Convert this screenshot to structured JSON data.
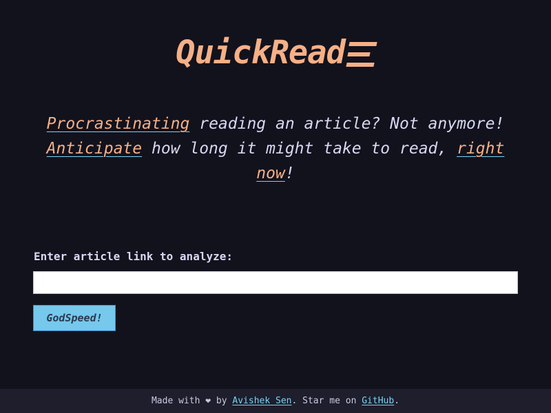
{
  "header": {
    "title": "QuickRead",
    "logo_icon": "hamburger-lines-icon"
  },
  "tagline": {
    "highlight_1": "Procrastinating",
    "text_1": " reading an article? Not anymore! ",
    "highlight_2": "Anticipate",
    "text_2": " how long it might take to read, ",
    "highlight_3": "right now",
    "text_3": "!"
  },
  "form": {
    "label": "Enter article link to analyze:",
    "input_value": "",
    "input_placeholder": "",
    "submit_label": "GodSpeed!"
  },
  "footer": {
    "text_1": "Made with ",
    "heart": "❤",
    "text_2": " by ",
    "author_link": "Avishek Sen",
    "text_3": ". Star me on ",
    "github_link": "GitHub",
    "text_4": "."
  },
  "colors": {
    "background": "#12121d",
    "accent_orange": "#f6b086",
    "accent_blue": "#7ad4f2",
    "button": "#76c8ec",
    "footer_bg": "#1e1e2c"
  }
}
